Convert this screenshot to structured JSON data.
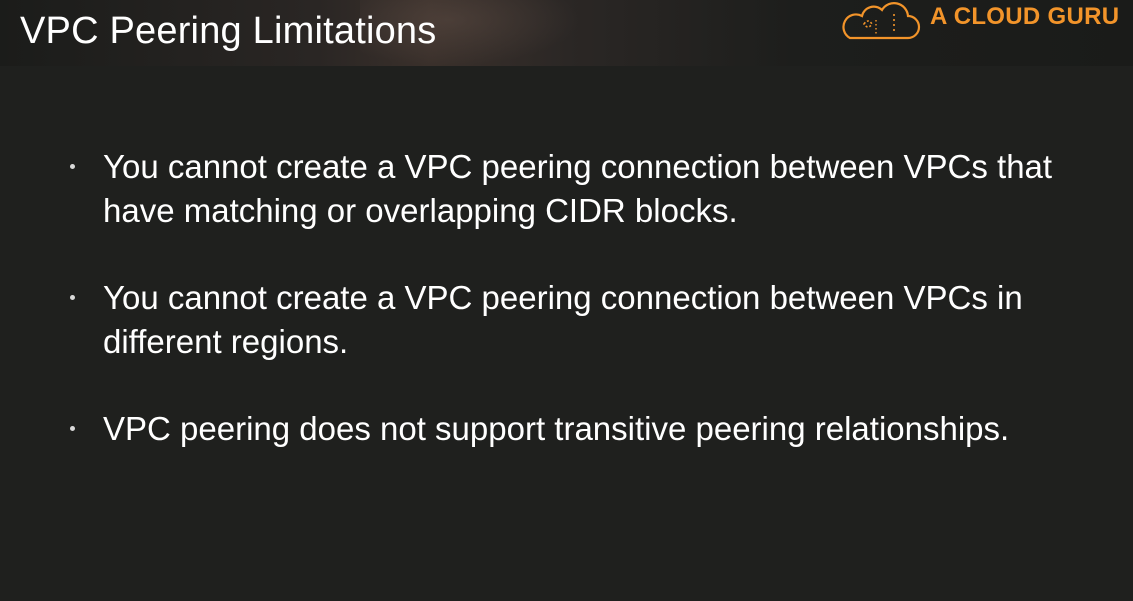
{
  "slide": {
    "title": "VPC Peering Limitations",
    "logo": {
      "text": "A CLOUD GURU",
      "icon": "cloud-logo-icon",
      "color": "#f2942a"
    },
    "bullets": [
      {
        "text": "You cannot create a VPC peering connection between VPCs that have matching or overlapping CIDR blocks."
      },
      {
        "text": "You cannot create a VPC peering connection between VPCs in different regions."
      },
      {
        "text": "VPC peering does not support transitive peering relationships."
      }
    ]
  }
}
